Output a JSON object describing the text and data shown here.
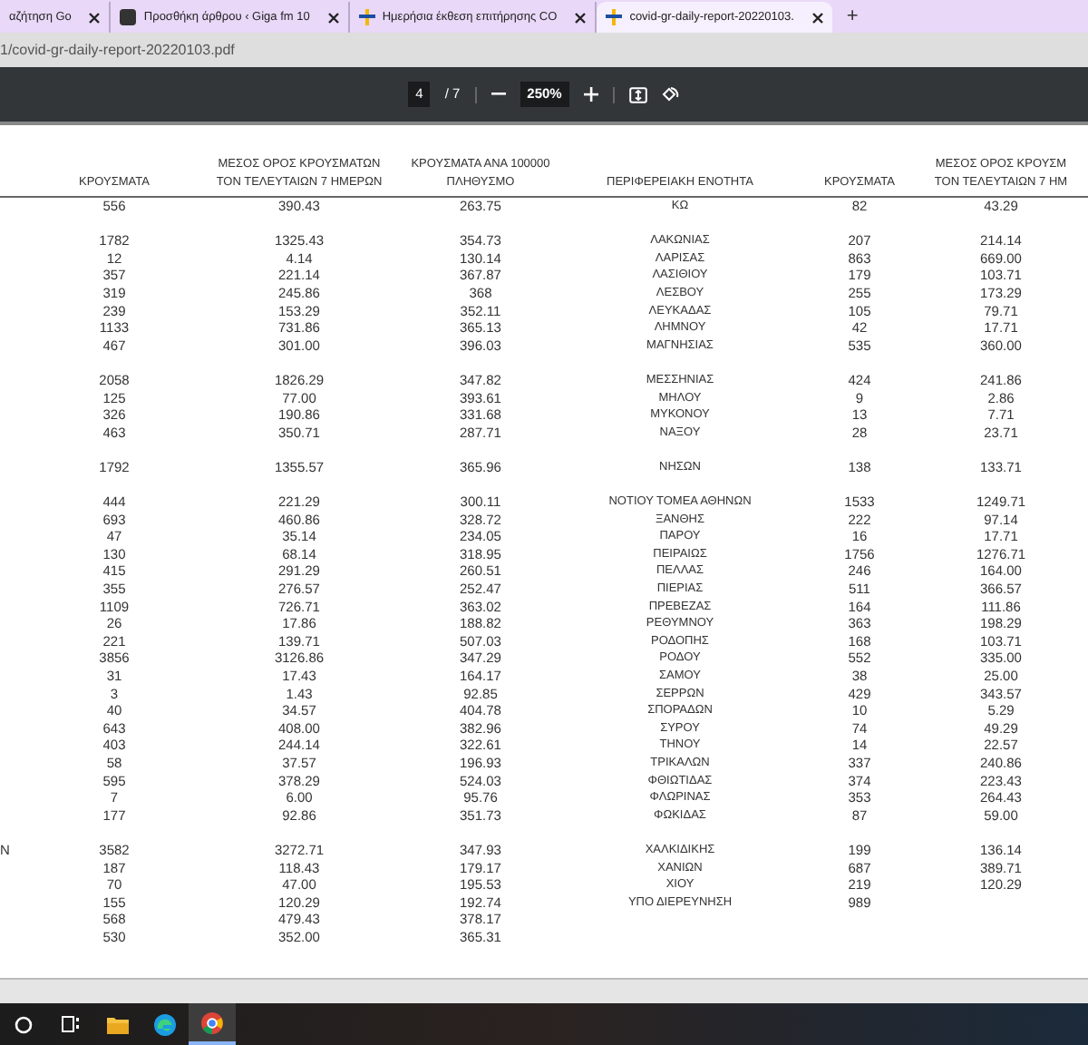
{
  "tabs": [
    {
      "kind": "cut",
      "label": "αζήτηση Go",
      "selected": false
    },
    {
      "kind": "giga",
      "label": "Προσθήκη άρθρου ‹ Giga fm 10",
      "selected": false
    },
    {
      "kind": "eody",
      "label": "Ημερήσια έκθεση επιτήρησης CO",
      "selected": false
    },
    {
      "kind": "eody",
      "label": "covid-gr-daily-report-20220103.",
      "selected": true
    }
  ],
  "new_tab": "+",
  "address": "1/covid-gr-daily-report-20220103.pdf",
  "pdf_toolbar": {
    "page": "4",
    "page_count": "/ 7",
    "zoom": "250%"
  },
  "table": {
    "columns": [
      {},
      {
        "lines": [
          "ΚΡΟΥΣΜΑΤΑ"
        ]
      },
      {
        "lines": [
          "ΜΕΣΟΣ ΟΡΟΣ ΚΡΟΥΣΜΑΤΩΝ",
          "ΤΟΝ ΤΕΛΕΥΤΑΙΩΝ 7 ΗΜΕΡΩΝ"
        ]
      },
      {
        "lines": [
          "ΚΡΟΥΣΜΑΤΑ ΑΝΑ 100000",
          "ΠΛΗΘΥΣΜΟ"
        ]
      },
      {
        "lines": [
          "ΠΕΡΙΦΕΡΕΙΑΚΗ ΕΝΟΤΗΤΑ"
        ]
      },
      {
        "lines": [
          "ΚΡΟΥΣΜΑΤΑ"
        ]
      },
      {
        "lines": [
          "ΜΕΣΟΣ ΟΡΟΣ ΚΡΟΥΣΜ",
          "ΤΟΝ ΤΕΛΕΥΤΑΙΩΝ 7 ΗΜ"
        ]
      }
    ],
    "groups": [
      {
        "rows": [
          {
            "cases": "556",
            "avg_7d": "390.43",
            "per_100k": "263.75",
            "region": "ΚΩ",
            "region_cases": "82",
            "region_avg_7d": "43.29"
          }
        ]
      },
      {
        "rows": [
          {
            "cases": "1782",
            "avg_7d": "1325.43",
            "per_100k": "354.73",
            "region": "ΛΑΚΩΝΙΑΣ",
            "region_cases": "207",
            "region_avg_7d": "214.14"
          },
          {
            "cases": "12",
            "avg_7d": "4.14",
            "per_100k": "130.14",
            "region": "ΛΑΡΙΣΑΣ",
            "region_cases": "863",
            "region_avg_7d": "669.00"
          },
          {
            "cases": "357",
            "avg_7d": "221.14",
            "per_100k": "367.87",
            "region": "ΛΑΣΙΘΙΟΥ",
            "region_cases": "179",
            "region_avg_7d": "103.71"
          },
          {
            "cases": "319",
            "avg_7d": "245.86",
            "per_100k": "368",
            "region": "ΛΕΣΒΟΥ",
            "region_cases": "255",
            "region_avg_7d": "173.29"
          },
          {
            "cases": "239",
            "avg_7d": "153.29",
            "per_100k": "352.11",
            "region": "ΛΕΥΚΑΔΑΣ",
            "region_cases": "105",
            "region_avg_7d": "79.71"
          },
          {
            "cases": "1133",
            "avg_7d": "731.86",
            "per_100k": "365.13",
            "region": "ΛΗΜΝΟΥ",
            "region_cases": "42",
            "region_avg_7d": "17.71"
          },
          {
            "cases": "467",
            "avg_7d": "301.00",
            "per_100k": "396.03",
            "region": "ΜΑΓΝΗΣΙΑΣ",
            "region_cases": "535",
            "region_avg_7d": "360.00"
          }
        ]
      },
      {
        "rows": [
          {
            "cases": "2058",
            "avg_7d": "1826.29",
            "per_100k": "347.82",
            "region": "ΜΕΣΣΗΝΙΑΣ",
            "region_cases": "424",
            "region_avg_7d": "241.86"
          },
          {
            "cases": "125",
            "avg_7d": "77.00",
            "per_100k": "393.61",
            "region": "ΜΗΛΟΥ",
            "region_cases": "9",
            "region_avg_7d": "2.86"
          },
          {
            "cases": "326",
            "avg_7d": "190.86",
            "per_100k": "331.68",
            "region": "ΜΥΚΟΝΟΥ",
            "region_cases": "13",
            "region_avg_7d": "7.71"
          },
          {
            "cases": "463",
            "avg_7d": "350.71",
            "per_100k": "287.71",
            "region": "ΝΑΞΟΥ",
            "region_cases": "28",
            "region_avg_7d": "23.71"
          }
        ]
      },
      {
        "rows": [
          {
            "cases": "1792",
            "avg_7d": "1355.57",
            "per_100k": "365.96",
            "region": "ΝΗΣΩΝ",
            "region_cases": "138",
            "region_avg_7d": "133.71"
          }
        ]
      },
      {
        "rows": [
          {
            "cases": "444",
            "avg_7d": "221.29",
            "per_100k": "300.11",
            "region": "ΝΟΤΙΟΥ ΤΟΜΕΑ ΑΘΗΝΩΝ",
            "region_cases": "1533",
            "region_avg_7d": "1249.71"
          },
          {
            "cases": "693",
            "avg_7d": "460.86",
            "per_100k": "328.72",
            "region": "ΞΑΝΘΗΣ",
            "region_cases": "222",
            "region_avg_7d": "97.14"
          },
          {
            "cases": "47",
            "avg_7d": "35.14",
            "per_100k": "234.05",
            "region": "ΠΑΡΟΥ",
            "region_cases": "16",
            "region_avg_7d": "17.71"
          },
          {
            "cases": "130",
            "avg_7d": "68.14",
            "per_100k": "318.95",
            "region": "ΠΕΙΡΑΙΩΣ",
            "region_cases": "1756",
            "region_avg_7d": "1276.71"
          },
          {
            "cases": "415",
            "avg_7d": "291.29",
            "per_100k": "260.51",
            "region": "ΠΕΛΛΑΣ",
            "region_cases": "246",
            "region_avg_7d": "164.00"
          },
          {
            "cases": "355",
            "avg_7d": "276.57",
            "per_100k": "252.47",
            "region": "ΠΙΕΡΙΑΣ",
            "region_cases": "511",
            "region_avg_7d": "366.57"
          },
          {
            "cases": "1109",
            "avg_7d": "726.71",
            "per_100k": "363.02",
            "region": "ΠΡΕΒΕΖΑΣ",
            "region_cases": "164",
            "region_avg_7d": "111.86"
          },
          {
            "cases": "26",
            "avg_7d": "17.86",
            "per_100k": "188.82",
            "region": "ΡΕΘΥΜΝΟΥ",
            "region_cases": "363",
            "region_avg_7d": "198.29"
          },
          {
            "cases": "221",
            "avg_7d": "139.71",
            "per_100k": "507.03",
            "region": "ΡΟΔΟΠΗΣ",
            "region_cases": "168",
            "region_avg_7d": "103.71"
          },
          {
            "cases": "3856",
            "avg_7d": "3126.86",
            "per_100k": "347.29",
            "region": "ΡΟΔΟΥ",
            "region_cases": "552",
            "region_avg_7d": "335.00"
          },
          {
            "cases": "31",
            "avg_7d": "17.43",
            "per_100k": "164.17",
            "region": "ΣΑΜΟΥ",
            "region_cases": "38",
            "region_avg_7d": "25.00"
          },
          {
            "cases": "3",
            "avg_7d": "1.43",
            "per_100k": "92.85",
            "region": "ΣΕΡΡΩΝ",
            "region_cases": "429",
            "region_avg_7d": "343.57"
          },
          {
            "cases": "40",
            "avg_7d": "34.57",
            "per_100k": "404.78",
            "region": "ΣΠΟΡΑΔΩΝ",
            "region_cases": "10",
            "region_avg_7d": "5.29"
          },
          {
            "cases": "643",
            "avg_7d": "408.00",
            "per_100k": "382.96",
            "region": "ΣΥΡΟΥ",
            "region_cases": "74",
            "region_avg_7d": "49.29"
          },
          {
            "cases": "403",
            "avg_7d": "244.14",
            "per_100k": "322.61",
            "region": "ΤΗΝΟΥ",
            "region_cases": "14",
            "region_avg_7d": "22.57"
          },
          {
            "cases": "58",
            "avg_7d": "37.57",
            "per_100k": "196.93",
            "region": "ΤΡΙΚΑΛΩΝ",
            "region_cases": "337",
            "region_avg_7d": "240.86"
          },
          {
            "cases": "595",
            "avg_7d": "378.29",
            "per_100k": "524.03",
            "region": "ΦΘΙΩΤΙΔΑΣ",
            "region_cases": "374",
            "region_avg_7d": "223.43"
          },
          {
            "cases": "7",
            "avg_7d": "6.00",
            "per_100k": "95.76",
            "region": "ΦΛΩΡΙΝΑΣ",
            "region_cases": "353",
            "region_avg_7d": "264.43"
          },
          {
            "cases": "177",
            "avg_7d": "92.86",
            "per_100k": "351.73",
            "region": "ΦΩΚΙΔΑΣ",
            "region_cases": "87",
            "region_avg_7d": "59.00"
          }
        ]
      },
      {
        "rows": [
          {
            "column_1": "N",
            "cases": "3582",
            "avg_7d": "3272.71",
            "per_100k": "347.93",
            "region": "ΧΑΛΚΙΔΙΚΗΣ",
            "region_cases": "199",
            "region_avg_7d": "136.14"
          },
          {
            "cases": "187",
            "avg_7d": "118.43",
            "per_100k": "179.17",
            "region": "ΧΑΝΙΩΝ",
            "region_cases": "687",
            "region_avg_7d": "389.71"
          },
          {
            "cases": "70",
            "avg_7d": "47.00",
            "per_100k": "195.53",
            "region": "ΧΙΟΥ",
            "region_cases": "219",
            "region_avg_7d": "120.29"
          },
          {
            "cases": "155",
            "avg_7d": "120.29",
            "per_100k": "192.74",
            "region": "ΥΠΟ ΔΙΕΡΕΥΝΗΣΗ",
            "region_cases": "989"
          },
          {
            "cases": "568",
            "avg_7d": "479.43",
            "per_100k": "378.17"
          },
          {
            "cases": "530",
            "avg_7d": "352.00",
            "per_100k": "365.31"
          }
        ]
      }
    ]
  },
  "taskbar": [
    {
      "kind": "search",
      "selected": false
    },
    {
      "kind": "taskview",
      "selected": false
    },
    {
      "kind": "folder",
      "selected": false
    },
    {
      "kind": "edge",
      "selected": false
    },
    {
      "kind": "chrome",
      "selected": true
    }
  ]
}
